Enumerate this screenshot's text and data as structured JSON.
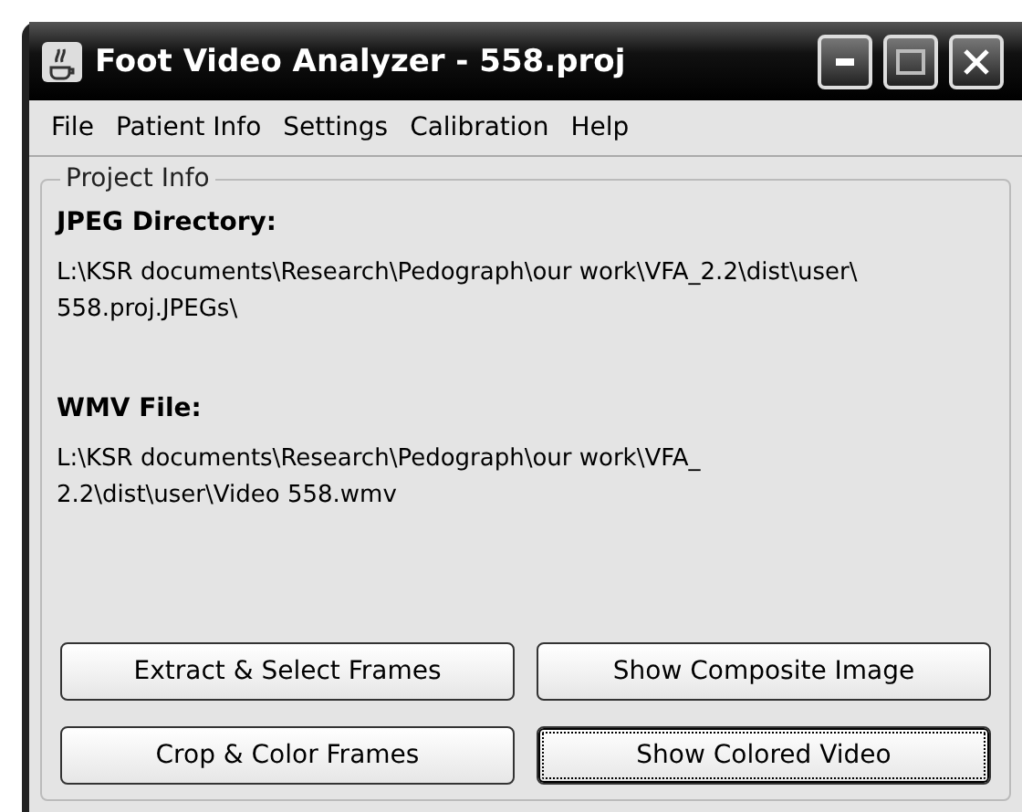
{
  "window": {
    "title": "Foot Video Analyzer - 558.proj"
  },
  "menu": [
    "File",
    "Patient Info",
    "Settings",
    "Calibration",
    "Help"
  ],
  "group": {
    "title": "Project Info",
    "fields": [
      {
        "label": "JPEG Directory:",
        "lines": [
          "L:\\KSR documents\\Research\\Pedograph\\our work\\VFA_2.2\\dist\\user\\",
          "558.proj.JPEGs\\"
        ]
      },
      {
        "label": "WMV File:",
        "lines": [
          "L:\\KSR documents\\Research\\Pedograph\\our work\\VFA_",
          "2.2\\dist\\user\\Video 558.wmv"
        ]
      }
    ],
    "buttons": [
      {
        "label": "Extract & Select Frames",
        "focused": false
      },
      {
        "label": "Show Composite Image",
        "focused": false
      },
      {
        "label": "Crop & Color Frames",
        "focused": false
      },
      {
        "label": "Show Colored Video",
        "focused": true
      }
    ]
  }
}
